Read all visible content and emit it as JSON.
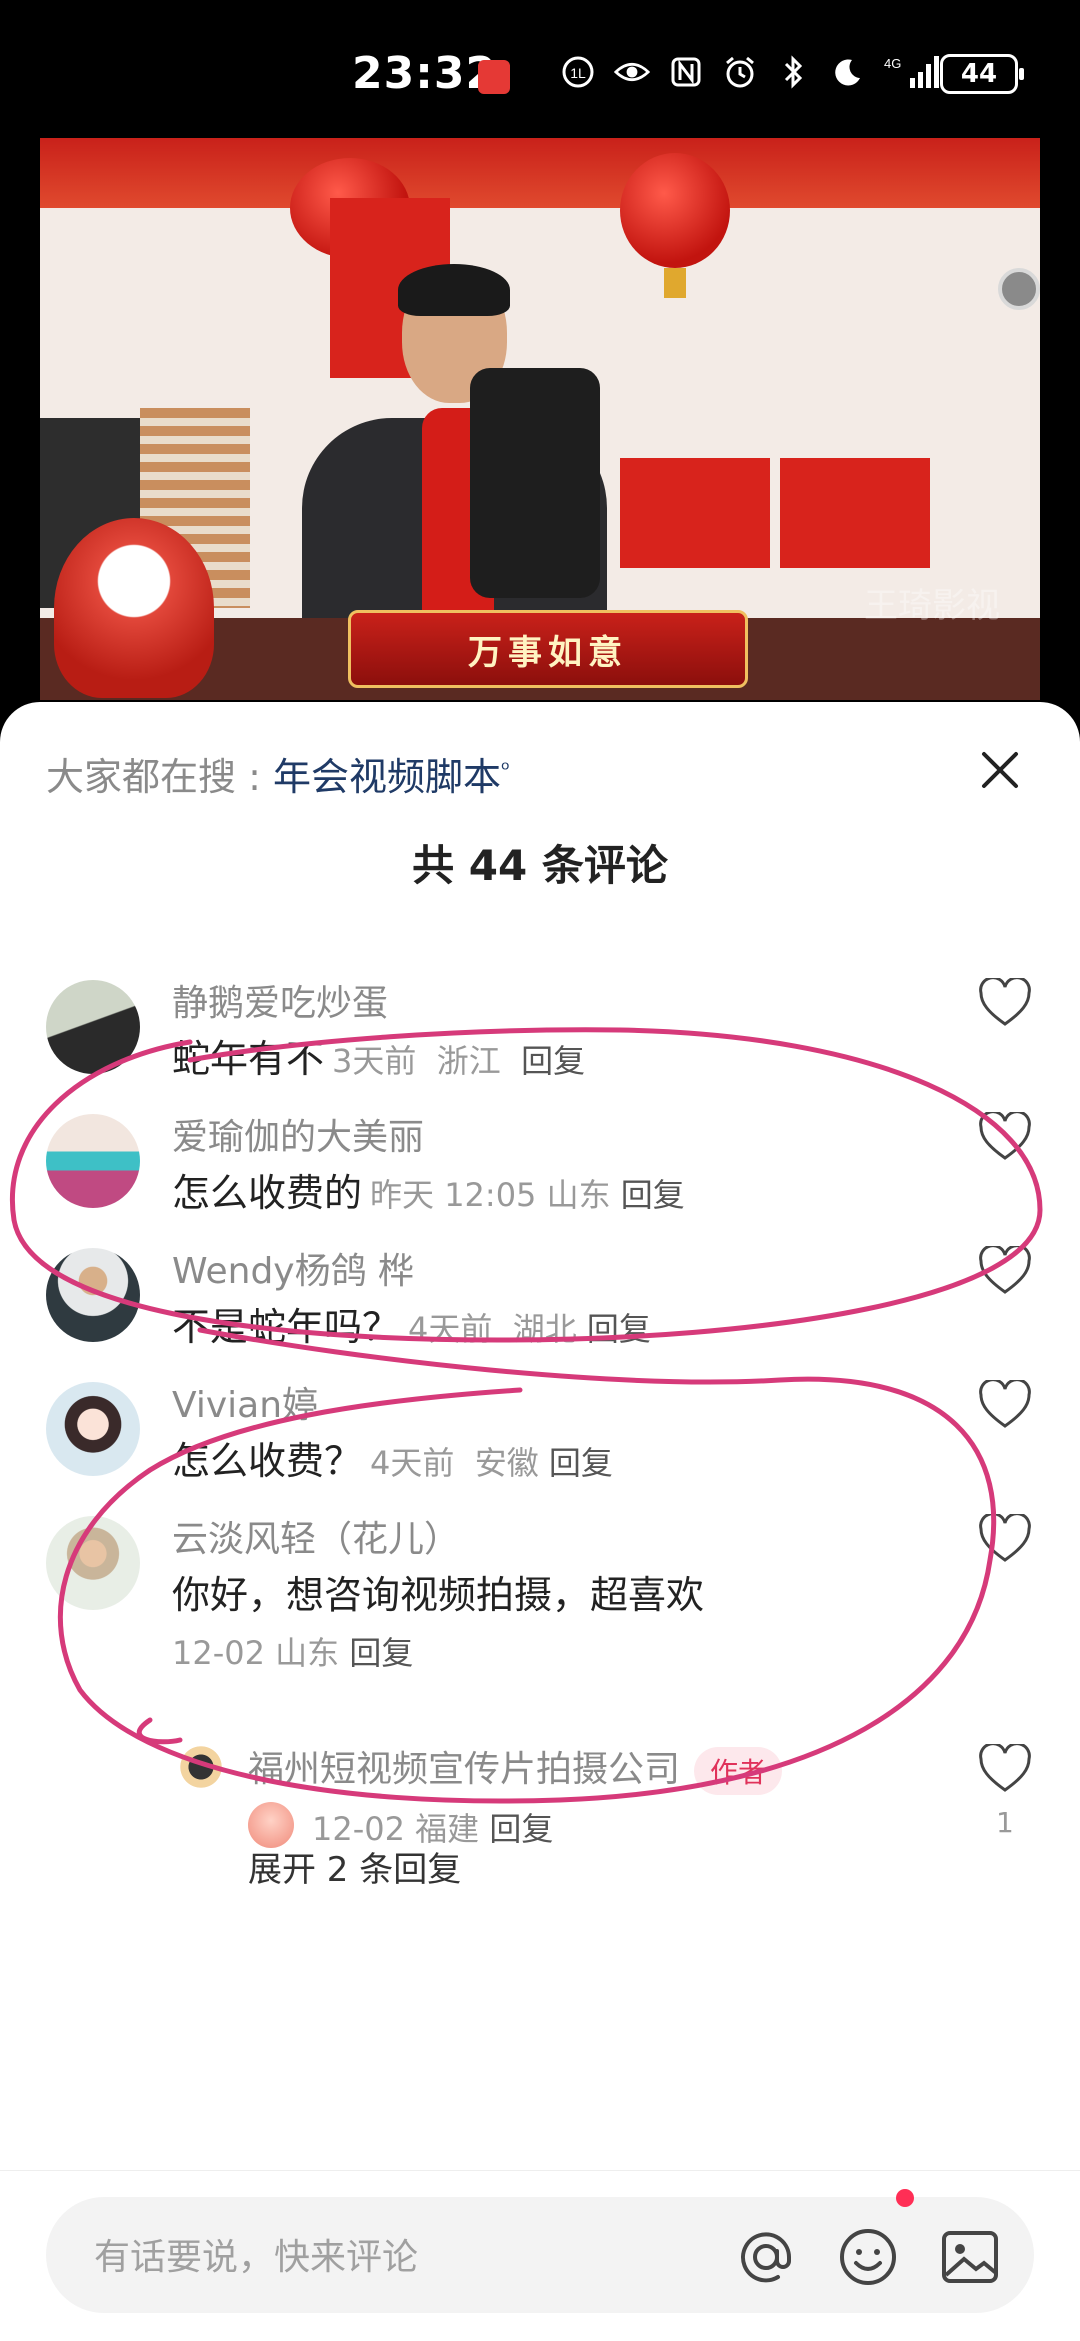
{
  "status_bar": {
    "time": "23:32",
    "battery": "44",
    "network": "4G",
    "icons": [
      "hd-call-icon",
      "eye-icon",
      "nfc-icon",
      "alarm-icon",
      "bluetooth-icon",
      "moon-icon",
      "signal-icon"
    ]
  },
  "video": {
    "banner_text": "万事如意",
    "watermark": "王琦影视"
  },
  "comments_panel": {
    "search_prefix": "大家都在搜 : ",
    "search_term": "年会视频脚本",
    "title": "共 44 条评论",
    "comments": [
      {
        "user": "静鹅爱吃炒蛋",
        "text": "蛇年有不",
        "time": "3天前",
        "location": "浙江",
        "reply": "回复"
      },
      {
        "user": "爱瑜伽的大美丽",
        "text": "怎么收费的",
        "time": "昨天 12:05",
        "location": "山东",
        "reply": "回复"
      },
      {
        "user": "Wendy杨鸽 桦",
        "text": "不是蛇年吗？",
        "time": "4天前",
        "location": "湖北",
        "reply": "回复"
      },
      {
        "user": "Vivian婷",
        "text": "怎么收费？",
        "time": "4天前",
        "location": "安徽",
        "reply": "回复"
      },
      {
        "user": "云淡风轻（花儿）",
        "text": "你好，想咨询视频拍摄，超喜欢",
        "time": "12-02",
        "location": "山东",
        "reply": "回复"
      }
    ],
    "author_reply": {
      "user": "福州短视频宣传片拍摄公司",
      "tag": "作者",
      "time": "12-02",
      "location": "福建",
      "reply": "回复",
      "likes": "1"
    },
    "expand_text": "展开 2 条回复"
  },
  "input_bar": {
    "placeholder": "有话要说，快来评论",
    "icons": [
      "at-icon",
      "emoji-icon",
      "image-icon"
    ]
  },
  "colors": {
    "annotation": "#d63a7a",
    "author_tag_bg": "#fde8ec",
    "author_tag_text": "#e0325a",
    "search_term": "#1f3a66"
  }
}
